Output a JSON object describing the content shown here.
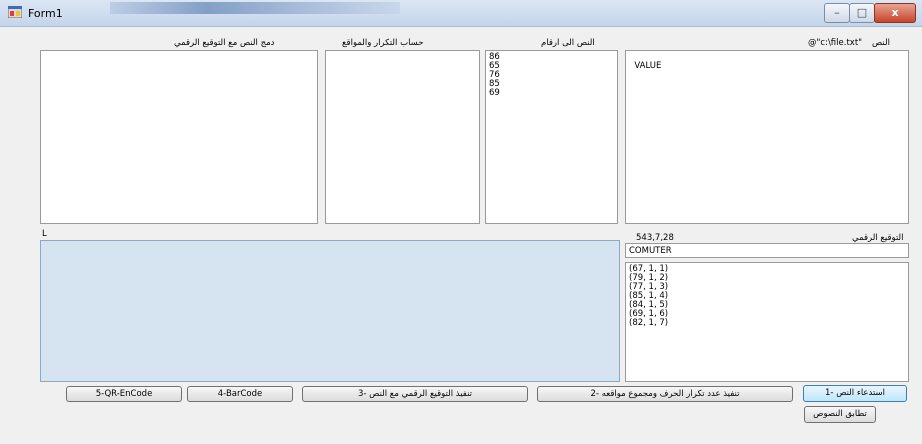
{
  "window": {
    "title": "Form1",
    "minimize": "–",
    "maximize": "□",
    "close": "x"
  },
  "labels": {
    "text_label": "النص",
    "file_path": "@\"c:\\file.txt\"",
    "text_to_numbers": "النص الى ارقام",
    "count_positions": "حساب التكرار والمواقع",
    "merge_signature": "دمج النص مع التوقيع الرقمي",
    "digital_signature": "التوقيع الرقمي",
    "signature_value": "543,7,28",
    "l_label": "L"
  },
  "panels": {
    "text_content": "VALUE",
    "numbers": [
      "86",
      "65",
      "76",
      "85",
      "69"
    ],
    "computer_word": "COMUTER",
    "tuples": [
      "(67, 1, 1)",
      "(79, 1, 2)",
      "(77, 1, 3)",
      "(85, 1, 4)",
      "(84, 1, 5)",
      "(69, 1, 6)",
      "(82, 1, 7)"
    ]
  },
  "buttons": {
    "b1": "استدعاء النص -1",
    "b2": "تنفيذ عدد تكرار الحرف ومجموع مواقعه -2",
    "b3": "تنفيذ التوقيع الرقمي مع النص -3",
    "b4": "4-BarCode",
    "b5": "5-QR-EnCode",
    "match": "تطابق النصوص"
  }
}
